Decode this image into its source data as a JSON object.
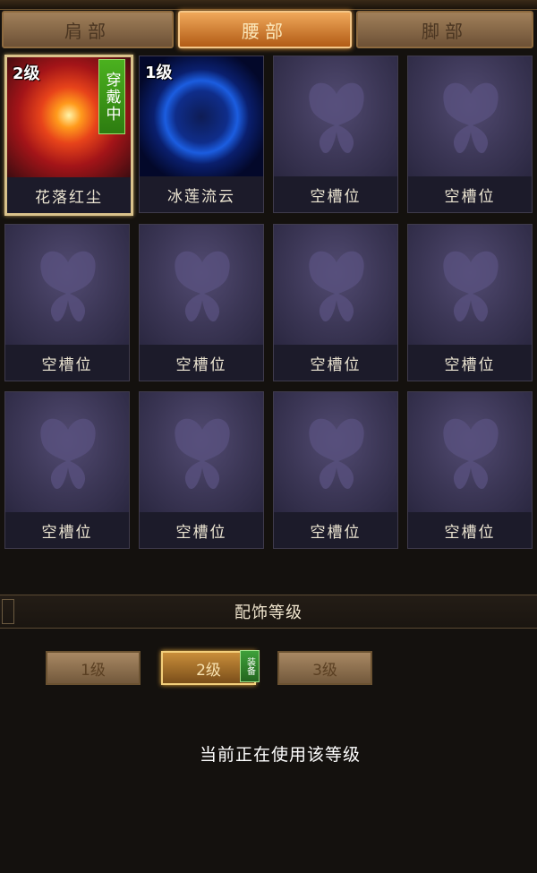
{
  "tabs": [
    {
      "label": "肩部",
      "active": false
    },
    {
      "label": "腰部",
      "active": true
    },
    {
      "label": "脚部",
      "active": false
    }
  ],
  "slots": [
    {
      "label": "花落红尘",
      "level": "2级",
      "status": "穿戴中",
      "icon": "red-burst-icon"
    },
    {
      "label": "冰莲流云",
      "level": "1级",
      "icon": "blue-orb-icon"
    },
    {
      "label": "空槽位",
      "icon": "butterfly-icon"
    },
    {
      "label": "空槽位",
      "icon": "butterfly-icon"
    },
    {
      "label": "空槽位",
      "icon": "butterfly-icon"
    },
    {
      "label": "空槽位",
      "icon": "butterfly-icon"
    },
    {
      "label": "空槽位",
      "icon": "butterfly-icon"
    },
    {
      "label": "空槽位",
      "icon": "butterfly-icon"
    },
    {
      "label": "空槽位",
      "icon": "butterfly-icon"
    },
    {
      "label": "空槽位",
      "icon": "butterfly-icon"
    },
    {
      "label": "空槽位",
      "icon": "butterfly-icon"
    },
    {
      "label": "空槽位",
      "icon": "butterfly-icon"
    }
  ],
  "level_section": {
    "title": "配饰等级",
    "buttons": [
      {
        "label": "1级",
        "active": false
      },
      {
        "label": "2级",
        "active": true
      },
      {
        "label": "3级",
        "active": false
      }
    ],
    "equip_tag": "装备",
    "status_text": "当前正在使用该等级"
  }
}
